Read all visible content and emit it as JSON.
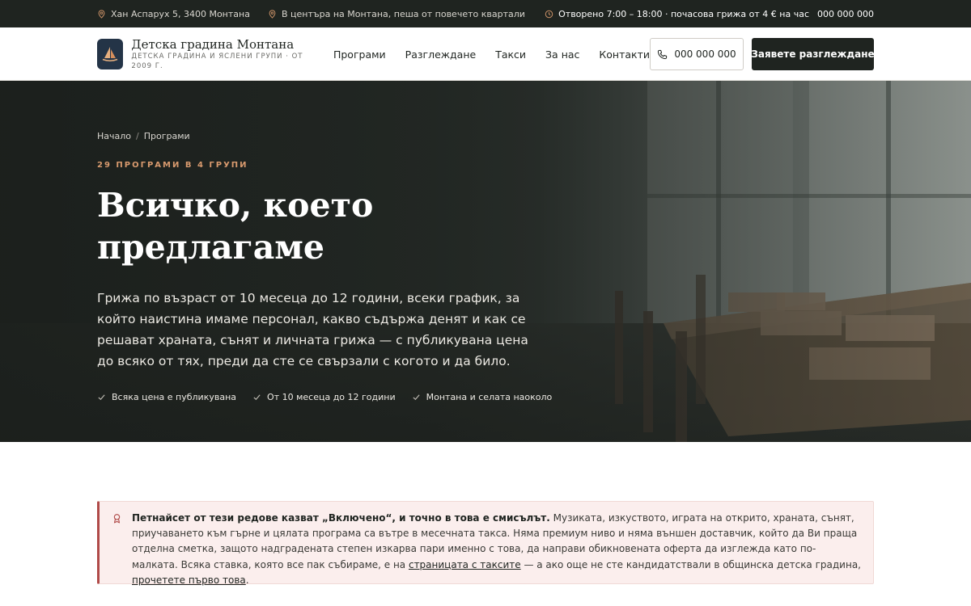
{
  "topbar": {
    "address": "Хан Аспарух 5, 3400 Монтана",
    "location": "В центъра на Монтана, пеша от повечето квартали",
    "hours": "Отворено 7:00 – 18:00 · почасова грижа от 4 € на час",
    "phone": "000 000 000"
  },
  "header": {
    "brand_name": "Детска градина Монтана",
    "brand_tagline": "Детска градина и ясле​ни групи · от 2009 г.",
    "nav": [
      "Програми",
      "Разглеждане",
      "Такси",
      "За нас",
      "Контакти"
    ],
    "phone_label": "000 000 000",
    "cta_label": "Заявете разглеждане"
  },
  "hero": {
    "breadcrumb_home": "Начало",
    "breadcrumb_sep": "/",
    "breadcrumb_current": "Програми",
    "eyebrow": "29 програми в 4 групи",
    "title": "Всичко, което предлагаме",
    "subtitle": "Грижа по възраст от 10 месеца до 12 години, всеки график, за който наистина имаме персонал, какво съдържа денят и как се решават храната, сънят и личната грижа — с публикувана цена до всяко от тях, преди да сте се свързали с когото и да било.",
    "badges": [
      "Всяка цена е публикувана",
      "От 10 месеца до 12 години",
      "Монтана и селата наоколо"
    ]
  },
  "notice": {
    "lead": "Петнайсет от тези редове казват „Включено“, и точно в това е смисълът.",
    "body": " Музиката, изкуството, играта на открито, храната, сънят, приучаването към гърне и цялата програма са вътре в месечната такса. Няма премиум ниво и няма външен доставчик, който да Ви праща отделна сметка, защото надградената степен изкарва пари именно с това, да направи обикновената оферта да изглежда като по-малката. Всяка ставка, която все пак събираме, е на ",
    "link1": "страницата с таксите",
    "middle": " — а ако още не сте кандидатствали в общинска детска градина, ",
    "link2": "прочетете първо това",
    "end": "."
  },
  "colors": {
    "dark": "#1f2420",
    "accent": "#d89a6e",
    "notice_bg": "#fbeeed",
    "notice_border": "#b04a48"
  }
}
